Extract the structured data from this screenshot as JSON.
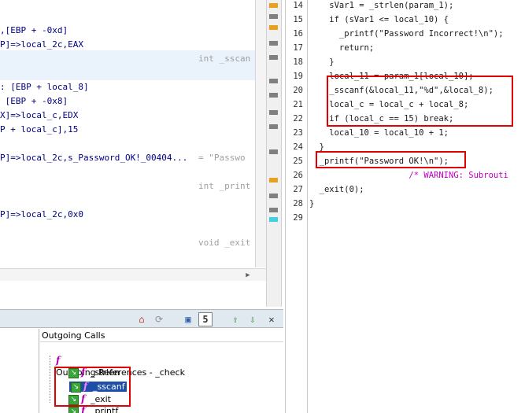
{
  "listing": {
    "rows": [
      {
        "text": ",[EBP + -0xd]"
      },
      {
        "text": "P]=>local_2c,EAX"
      },
      {
        "text": ""
      },
      {
        "text": ""
      },
      {
        "text": ": [EBP + local_8]"
      },
      {
        "text": " [EBP + -0x8]"
      },
      {
        "text": "X]=>local_c,EDX"
      },
      {
        "text": "P + local_c],15"
      },
      {
        "text": ""
      },
      {
        "text": "P]=>local_2c,s_Password_OK!_00404..."
      },
      {
        "text": ""
      },
      {
        "text": ""
      },
      {
        "text": ""
      },
      {
        "text": ""
      },
      {
        "text": "P]=>local_2c,0x0"
      }
    ],
    "comments": {
      "sscanf": "int _sscan",
      "password": "= \"Passwo",
      "printf": "int _print",
      "exit": "void _exit"
    }
  },
  "decompiler": {
    "line_numbers": [
      "14",
      "15",
      "16",
      "17",
      "18",
      "19",
      "20",
      "21",
      "22",
      "23",
      "24",
      "25",
      "26",
      "27",
      "28",
      "29"
    ],
    "lines": [
      "    sVar1 = _strlen(param_1);",
      "    if (sVar1 <= local_10) {",
      "      _printf(\"Password Incorrect!\\n\");",
      "      return;",
      "    }",
      "    local_11 = param_1[local_10];",
      "    _sscanf(&local_11,\"%d\",&local_8);",
      "    local_c = local_c + local_8;",
      "    if (local_c == 15) break;",
      "    local_10 = local_10 + 1;",
      "  }",
      "  _printf(\"Password OK!\\n\");",
      "                    /* WARNING: Subrouti",
      "  _exit(0);",
      "}",
      ""
    ]
  },
  "toolbar": {
    "count": "5",
    "close": "✕"
  },
  "calls": {
    "header": "Outgoing Calls",
    "root": "Outgoing References - _check",
    "items": [
      "_strlen",
      "_sscanf",
      "_exit",
      "_printf"
    ]
  },
  "colors": {
    "highlight_box": "#e00000",
    "selection": "#1e4fa8"
  }
}
